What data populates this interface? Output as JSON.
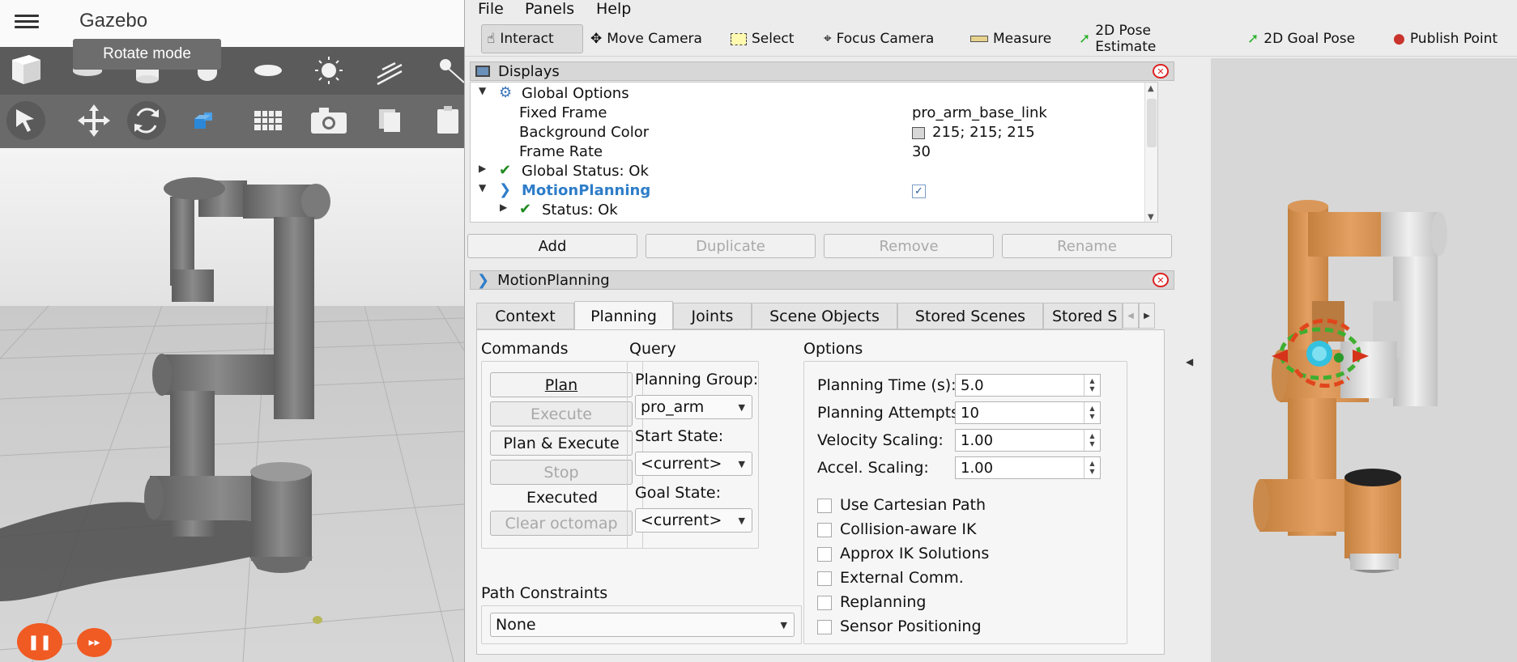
{
  "gazebo": {
    "title": "Gazebo",
    "tooltip": "Rotate mode",
    "shape_tools": [
      "box-icon",
      "sphere-icon",
      "cylinder-icon",
      "capsule-icon",
      "ellipsoid-icon",
      "sun-light-icon",
      "directional-light-icon",
      "spot-light-icon"
    ],
    "mode_tools": [
      "select-arrow-icon",
      "translate-icon",
      "rotate-icon",
      "scale-icon",
      "grid-snap-icon",
      "camera-screenshot-icon",
      "copy-icon",
      "paste-icon"
    ],
    "controls": [
      "pause-icon",
      "step-forward-icon"
    ]
  },
  "rviz": {
    "menu": {
      "file": "File",
      "panels": "Panels",
      "help": "Help"
    },
    "tools": [
      {
        "label": "Interact",
        "icon": "hand-cursor-icon",
        "active": true
      },
      {
        "label": "Move Camera",
        "icon": "move-camera-icon",
        "active": false
      },
      {
        "label": "Select",
        "icon": "select-box-icon",
        "active": false
      },
      {
        "label": "Focus Camera",
        "icon": "focus-camera-icon",
        "active": false
      },
      {
        "label": "Measure",
        "icon": "ruler-icon",
        "active": false
      },
      {
        "label": "2D Pose Estimate",
        "icon": "green-arrow-icon",
        "active": false
      },
      {
        "label": "2D Goal Pose",
        "icon": "green-arrow-icon",
        "active": false
      },
      {
        "label": "Publish Point",
        "icon": "map-pin-icon",
        "active": false
      }
    ],
    "displays": {
      "title": "Displays",
      "rows": [
        {
          "label": "Global Options",
          "value": ""
        },
        {
          "label": "Fixed Frame",
          "value": "pro_arm_base_link"
        },
        {
          "label": "Background Color",
          "value": "215; 215; 215"
        },
        {
          "label": "Frame Rate",
          "value": "30"
        },
        {
          "label": "Global Status: Ok",
          "value": ""
        },
        {
          "label": "MotionPlanning",
          "value": ""
        },
        {
          "label": "Status: Ok",
          "value": ""
        }
      ],
      "buttons": {
        "add": "Add",
        "duplicate": "Duplicate",
        "remove": "Remove",
        "rename": "Rename"
      }
    },
    "motion_planning": {
      "title": "MotionPlanning",
      "tabs": [
        "Context",
        "Planning",
        "Joints",
        "Scene Objects",
        "Stored Scenes",
        "Stored S"
      ],
      "commands": {
        "heading": "Commands",
        "plan": "Plan",
        "execute": "Execute",
        "plan_execute": "Plan & Execute",
        "stop": "Stop",
        "status": "Executed",
        "clear_octomap": "Clear octomap"
      },
      "query": {
        "heading": "Query",
        "group_label": "Planning Group:",
        "group_value": "pro_arm",
        "start_label": "Start State:",
        "start_value": "<current>",
        "goal_label": "Goal State:",
        "goal_value": "<current>"
      },
      "options": {
        "heading": "Options",
        "planning_time_label": "Planning Time (s):",
        "planning_time": "5.0",
        "planning_attempts_label": "Planning Attempts:",
        "planning_attempts": "10",
        "velocity_label": "Velocity Scaling:",
        "velocity": "1.00",
        "accel_label": "Accel. Scaling:",
        "accel": "1.00",
        "checks": [
          "Use Cartesian Path",
          "Collision-aware IK",
          "Approx IK Solutions",
          "External Comm.",
          "Replanning",
          "Sensor Positioning"
        ]
      },
      "path_constraints": {
        "label": "Path Constraints",
        "value": "None"
      }
    }
  }
}
